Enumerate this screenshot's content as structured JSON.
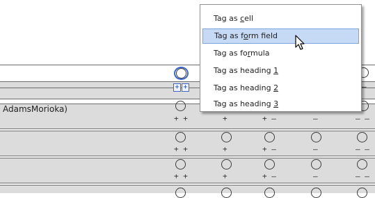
{
  "table": {
    "row_label": "AdamsMorioka)",
    "scale_strong_pos": "+ +",
    "scale_pos": "+",
    "scale_mixed": "+ –",
    "scale_neg": "–",
    "scale_strong_neg": "– –",
    "header_tag_1": "+",
    "header_tag_2": "+"
  },
  "context_menu": {
    "items": [
      {
        "label_pre": "Tag as ",
        "label_u": "c",
        "label_post": "ell"
      },
      {
        "label_pre": "Tag as f",
        "label_u": "o",
        "label_post": "rm field"
      },
      {
        "label_pre": "Tag as fo",
        "label_u": "r",
        "label_post": "mula"
      },
      {
        "label_pre": "Tag as heading ",
        "label_u": "1",
        "label_post": ""
      },
      {
        "label_pre": "Tag as heading ",
        "label_u": "2",
        "label_post": ""
      },
      {
        "label_pre": "Tag as heading ",
        "label_u": "3",
        "label_post": ""
      }
    ],
    "highlighted_index": 1
  },
  "colors": {
    "selection_blue": "#3b66cc",
    "menu_highlight": "#c6d9f5",
    "band_gray": "#dcdcdc"
  },
  "icons": {
    "pointer": "arrow-cursor-icon"
  }
}
